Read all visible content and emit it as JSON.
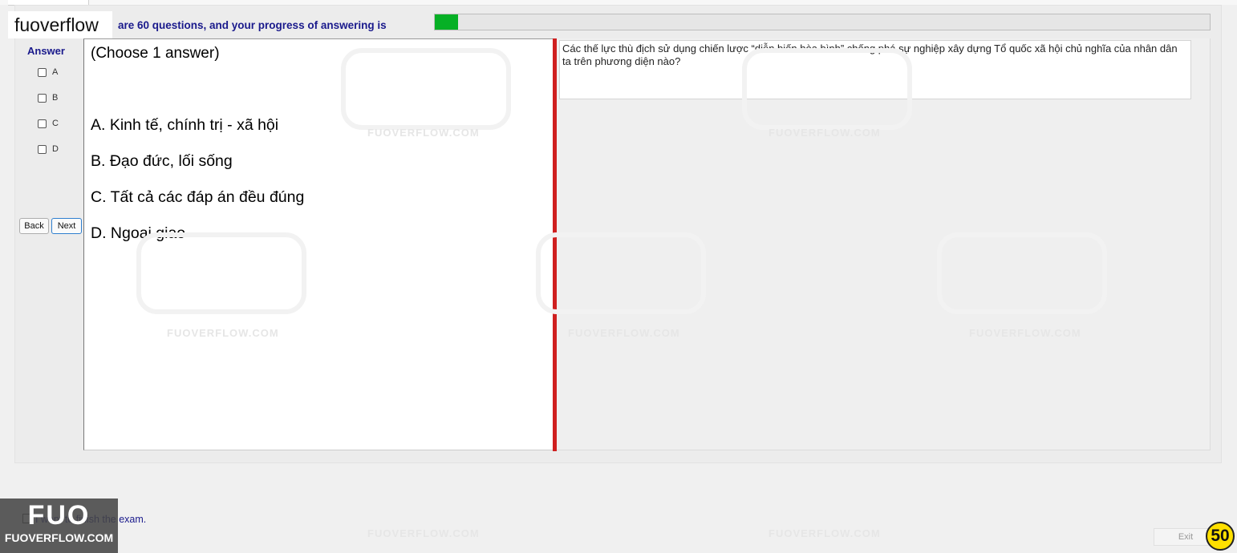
{
  "header": {
    "logo_text": "fuoverflow",
    "progress_text": "are 60 questions, and your progress of answering is",
    "progress_fraction": 0.03
  },
  "answer_sidebar": {
    "title": "Answer",
    "options": [
      "A",
      "B",
      "C",
      "D"
    ],
    "back_label": "Back",
    "next_label": "Next"
  },
  "answer_panel": {
    "hint": "(Choose 1 answer)",
    "options": [
      "A.  Kinh tế, chính trị - xã hội",
      "B.  Đạo đức, lối sống",
      "C.  Tất cả các đáp án đều đúng",
      "D.  Ngoại giao"
    ]
  },
  "question": {
    "text": "Các thế lực thù địch sử dụng chiến lược “diễn biến hòa bình” chống phá sự nghiệp xây dựng Tổ quốc xã hội chủ nghĩa của nhân dân ta trên phương diện nào?"
  },
  "watermark_text": "FUOVERFLOW.COM",
  "footer": {
    "finish_text": "I want to finish the exam.",
    "badge_big": "FUO",
    "badge_small": "FUOVERFLOW.COM",
    "exit_label": "Exit",
    "count": "50"
  },
  "colors": {
    "progress": "#06b025",
    "divider": "#cf1f1f",
    "label_blue": "#1a1a8c",
    "count_badge": "#ffe000"
  }
}
